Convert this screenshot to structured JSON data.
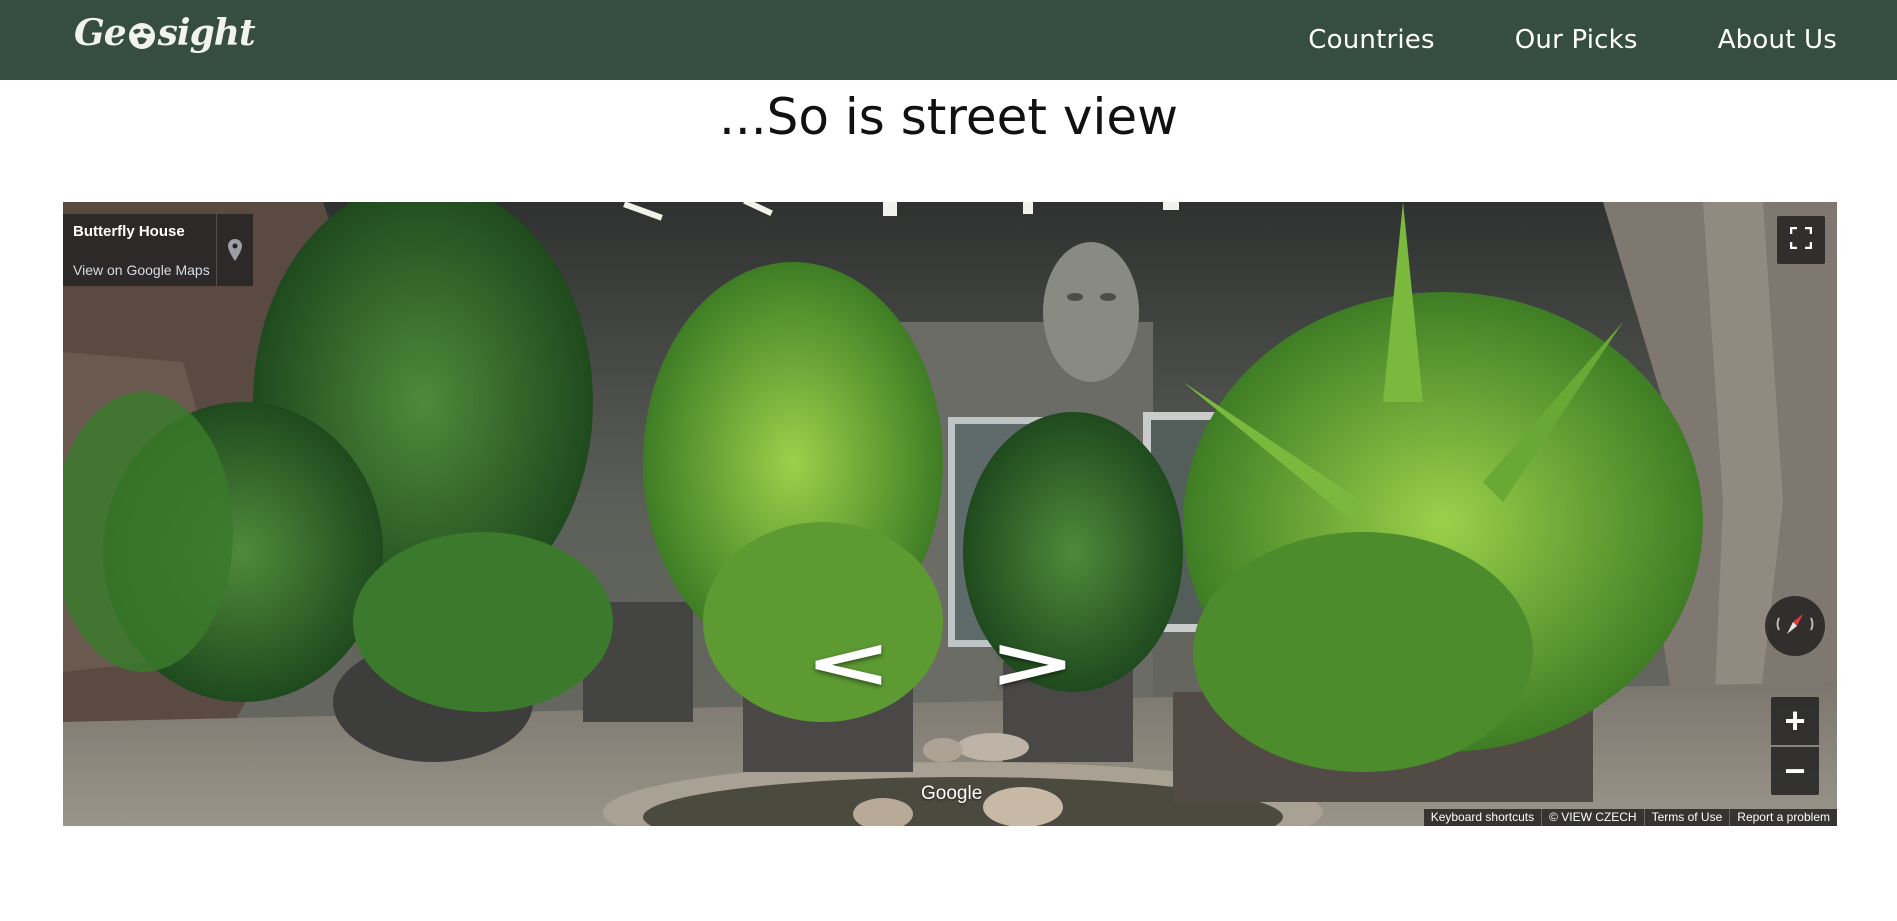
{
  "navbar": {
    "logo_text_left": "Ge",
    "logo_text_right": "sight",
    "links": [
      "Countries",
      "Our Picks",
      "About Us"
    ],
    "background": "#364e42"
  },
  "main": {
    "heading": "...So is street view"
  },
  "street_view": {
    "place_name": "Butterfly House",
    "view_on_maps": "View on Google Maps",
    "watermark": "Google",
    "prev_arrow": "<",
    "next_arrow": ">",
    "zoom_in": "+",
    "zoom_out": "−",
    "footer": {
      "keyboard": "Keyboard shortcuts",
      "copyright": "© VIEW CZECH",
      "terms": "Terms of Use",
      "report": "Report a problem"
    }
  }
}
